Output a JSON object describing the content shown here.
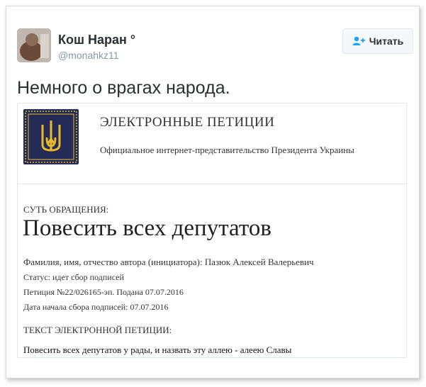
{
  "tweet": {
    "author_name": "Кош Наран °",
    "handle": "@monahkz11",
    "follow_label": "Читать",
    "text": "Немного о врагах народа."
  },
  "card": {
    "title": "ЭЛЕКТРОННЫЕ ПЕТИЦИИ",
    "subtitle": "Официальное интернет-представительство Президента Украины",
    "essence_label": "СУТЬ ОБРАЩЕНИЯ:",
    "headline": "Повесить всех депутатов",
    "author_line": "Фамилия, имя, отчество автора (инициатора): Пазюк Алексей Валерьевич",
    "status_line": "Статус: идет сбор подписей",
    "petition_line": "Петиция №22/026165-эп. Подана 07.07.2016",
    "start_date_line": "Дата начала сбора подписей: 07.07.2016",
    "text_label": "ТЕКСТ ЭЛЕКТРОННОЙ ПЕТИЦИИ:",
    "body": "Повесить всех депутатов у рады, и назвать эту аллею - алеею Славы"
  },
  "colors": {
    "emblem_bg": "#232a55",
    "emblem_gold": "#e8b92a",
    "follow_icon": "#1da1f2"
  }
}
